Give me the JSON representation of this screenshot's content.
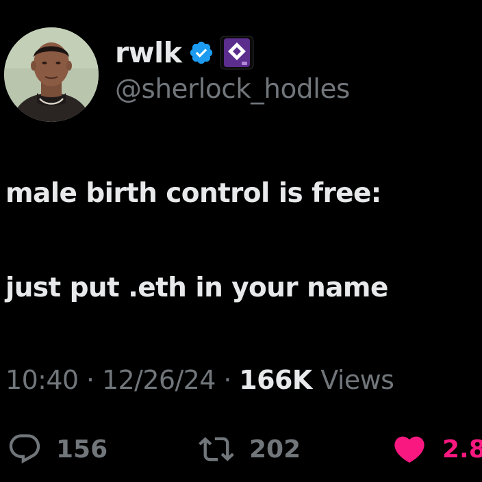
{
  "author": {
    "display_name": "rwlk",
    "handle": "@sherlock_hodles",
    "avatar": "profile-photo",
    "verified_icon": "verified-check-icon",
    "affiliate_badge_icon": "affiliate-org-icon"
  },
  "tweet": {
    "lines": [
      "male birth control is free:",
      "just put .eth in your name"
    ]
  },
  "meta": {
    "time": "10:40",
    "separator": "·",
    "date": "12/26/24",
    "views_count": "166K",
    "views_label": "Views"
  },
  "actions": {
    "replies": "156",
    "retweets": "202",
    "likes": "2.8"
  },
  "colors": {
    "background": "#000000",
    "text_primary": "#e7e9ea",
    "text_secondary": "#71767b",
    "verified_blue": "#1d9bf0",
    "like_pink": "#f91880",
    "affiliate_purple": "#5b2d8c"
  }
}
